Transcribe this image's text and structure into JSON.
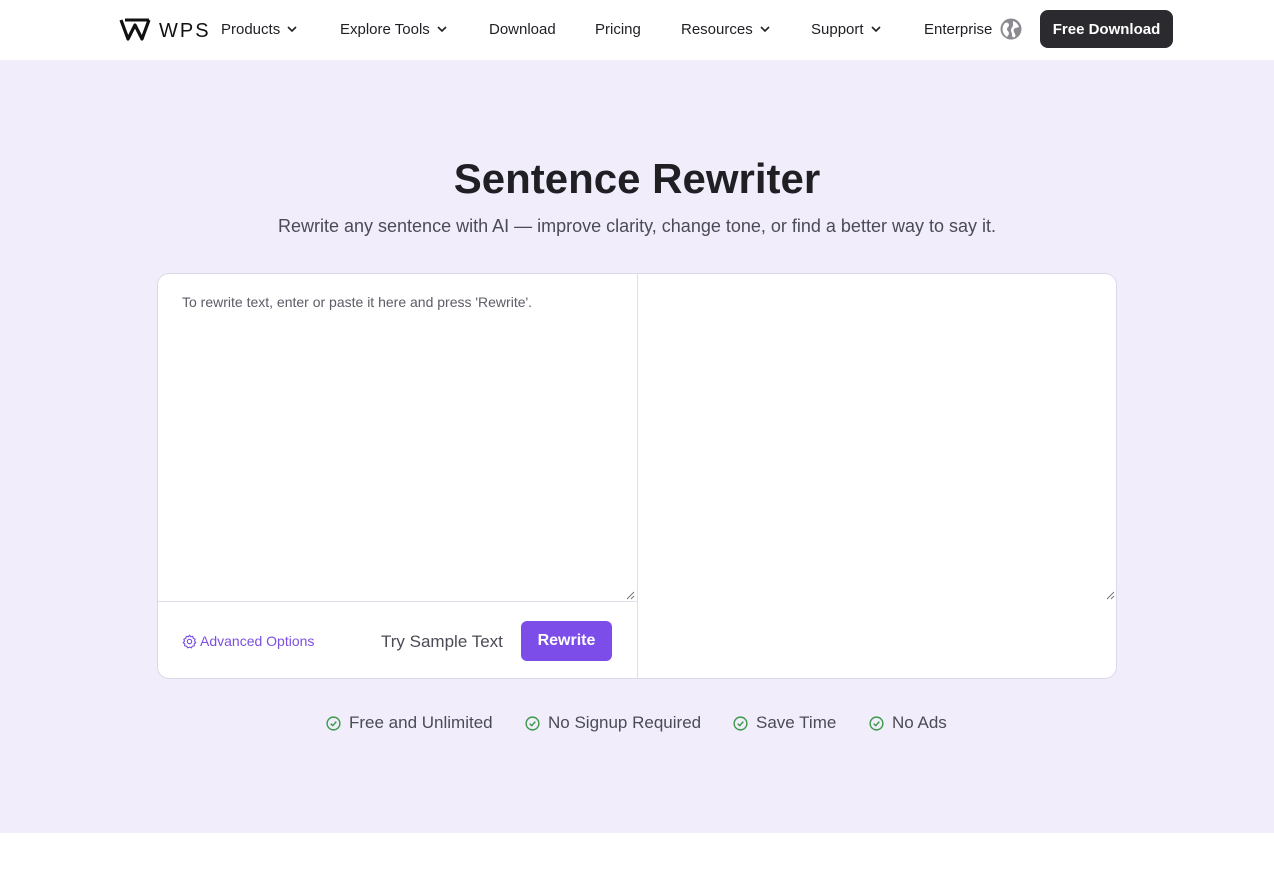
{
  "header": {
    "brand": "WPS",
    "nav": [
      {
        "label": "Products",
        "has_dropdown": true
      },
      {
        "label": "Explore Tools",
        "has_dropdown": true
      },
      {
        "label": "Download",
        "has_dropdown": false
      },
      {
        "label": "Pricing",
        "has_dropdown": false
      },
      {
        "label": "Resources",
        "has_dropdown": true
      },
      {
        "label": "Support",
        "has_dropdown": true
      },
      {
        "label": "Enterprise",
        "has_dropdown": false
      }
    ],
    "language_icon": "globe-icon",
    "cta_label": "Free Download"
  },
  "hero": {
    "title": "Sentence Rewriter",
    "subtitle": "Rewrite any sentence with AI — improve clarity, change tone, or find a better way to say it."
  },
  "tool": {
    "input_placeholder": "To rewrite text, enter or paste it here and press 'Rewrite'.",
    "input_value": "",
    "output_value": "",
    "advanced_options_label": "Advanced Options",
    "advanced_options_icon": "gear-icon",
    "sample_label": "Try Sample Text",
    "rewrite_label": "Rewrite"
  },
  "features": [
    {
      "label": "Free and Unlimited",
      "icon": "check-circle-icon"
    },
    {
      "label": "No Signup Required",
      "icon": "check-circle-icon"
    },
    {
      "label": "Save Time",
      "icon": "check-circle-icon"
    },
    {
      "label": "No Ads",
      "icon": "check-circle-icon"
    }
  ],
  "colors": {
    "accent": "#7c4de8",
    "hero_bg": "#f1edfb",
    "cta_bg": "#2b2b2f",
    "check": "#3a9a4a"
  }
}
